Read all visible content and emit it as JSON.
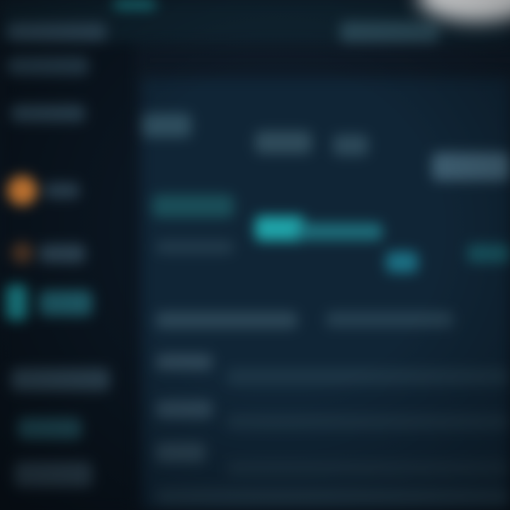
{
  "screen": {
    "legible_text": [],
    "colors": {
      "background": "#0d1824",
      "sidebar": "#0a1520",
      "panel": "#13293a",
      "accent_teal": "#1d8b93",
      "accent_orange": "#e58a3a",
      "text_block": "#3c5567",
      "glare": "#f2f4f6"
    }
  }
}
